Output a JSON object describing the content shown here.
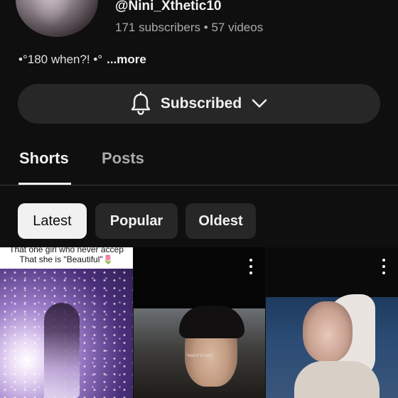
{
  "channel": {
    "handle": "@Nini_Xthetic10",
    "subscribers": "171 subscribers",
    "separator": "•",
    "videos": "57 videos",
    "description": "•°180 when?! •°",
    "more_label": "...more"
  },
  "subscribe_button": {
    "label": "Subscribed",
    "icon": "bell-icon",
    "dropdown_icon": "chevron-down-icon"
  },
  "tabs": [
    {
      "label": "Shorts",
      "active": true
    },
    {
      "label": "Posts",
      "active": false
    }
  ],
  "filters": [
    {
      "label": "Latest",
      "selected": true
    },
    {
      "label": "Popular",
      "selected": false
    },
    {
      "label": "Oldest",
      "selected": false
    }
  ],
  "shorts": [
    {
      "caption_line1": "That one girl who never accep",
      "caption_line2": "That she is \"Beautiful\"🌷"
    },
    {
      "overlay_text": "*watch til end*"
    },
    {}
  ],
  "colors": {
    "background": "#0f0f0f",
    "surface": "#272727",
    "text_primary": "#f1f1f1",
    "text_secondary": "#aaaaaa",
    "chip_selected_bg": "#f1f1f1"
  }
}
